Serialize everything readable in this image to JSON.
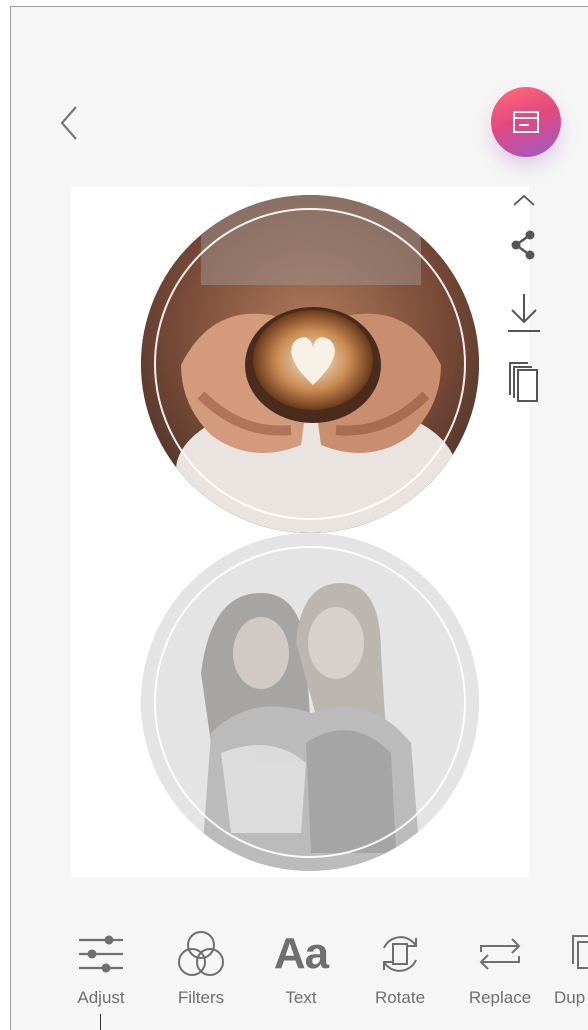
{
  "toolbar": {
    "items": [
      {
        "label": "Adjust"
      },
      {
        "label": "Filters"
      },
      {
        "label": "Text",
        "icon_text": "Aa"
      },
      {
        "label": "Rotate"
      },
      {
        "label": "Replace"
      },
      {
        "label": "Dup"
      }
    ]
  },
  "icons": {
    "back": "chevron-left-icon",
    "print": "printer-icon",
    "collapse": "chevron-up-icon",
    "share": "share-icon",
    "download": "download-icon",
    "copy": "copy-icon",
    "adjust": "sliders-icon",
    "filters": "filters-icon",
    "rotate": "rotate-icon",
    "replace": "replace-icon",
    "duplicate": "duplicate-icon"
  },
  "colors": {
    "background": "#f6f6f6",
    "icon": "#6f6f6f",
    "print_gradient_start": "#ff6d7a",
    "print_gradient_end": "#9b5ac9"
  }
}
